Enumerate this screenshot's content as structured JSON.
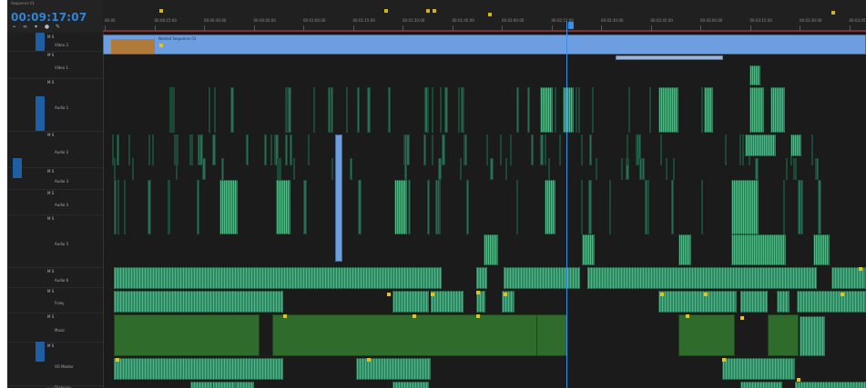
{
  "timecode": "00:09:17:07",
  "sequence_name": "Sequence 01",
  "tools": [
    "snap-icon",
    "linked-icon",
    "marker-icon",
    "settings-icon",
    "wrench-icon"
  ],
  "ruler": [
    "00:00",
    "00:00:15:00",
    "00:00:30:00",
    "00:00:45:00",
    "00:01:00:00",
    "00:01:15:00",
    "00:01:30:00",
    "00:01:45:00",
    "00:02:00:00",
    "00:02:15:00",
    "00:02:30:00",
    "00:02:45:00",
    "00:03:00:00",
    "00:03:15:00",
    "00:03:30:00",
    "00:03:45:00"
  ],
  "tracks": [
    {
      "name": "Video 2",
      "type": "video"
    },
    {
      "name": "Video 1",
      "type": "video"
    },
    {
      "name": "Audio 1",
      "type": "audio"
    },
    {
      "name": "Audio 2",
      "type": "audio"
    },
    {
      "name": "Audio 3",
      "type": "audio"
    },
    {
      "name": "Audio 4",
      "type": "audio"
    },
    {
      "name": "Audio 5",
      "type": "audio"
    },
    {
      "name": "Audio 6",
      "type": "audio"
    },
    {
      "name": "Foley",
      "type": "audio"
    },
    {
      "name": "Music",
      "type": "audio"
    },
    {
      "name": "VO Master",
      "type": "audio"
    },
    {
      "name": "Dialogue",
      "type": "audio"
    }
  ],
  "video_clip_label": "Nested Sequence 01",
  "colors": {
    "accent": "#2f86d8",
    "video_clip": "#6d9ee0",
    "audio_clip": "#2e8a62",
    "music_clip": "#2f6b2b",
    "keyframe": "#e6c21a"
  }
}
